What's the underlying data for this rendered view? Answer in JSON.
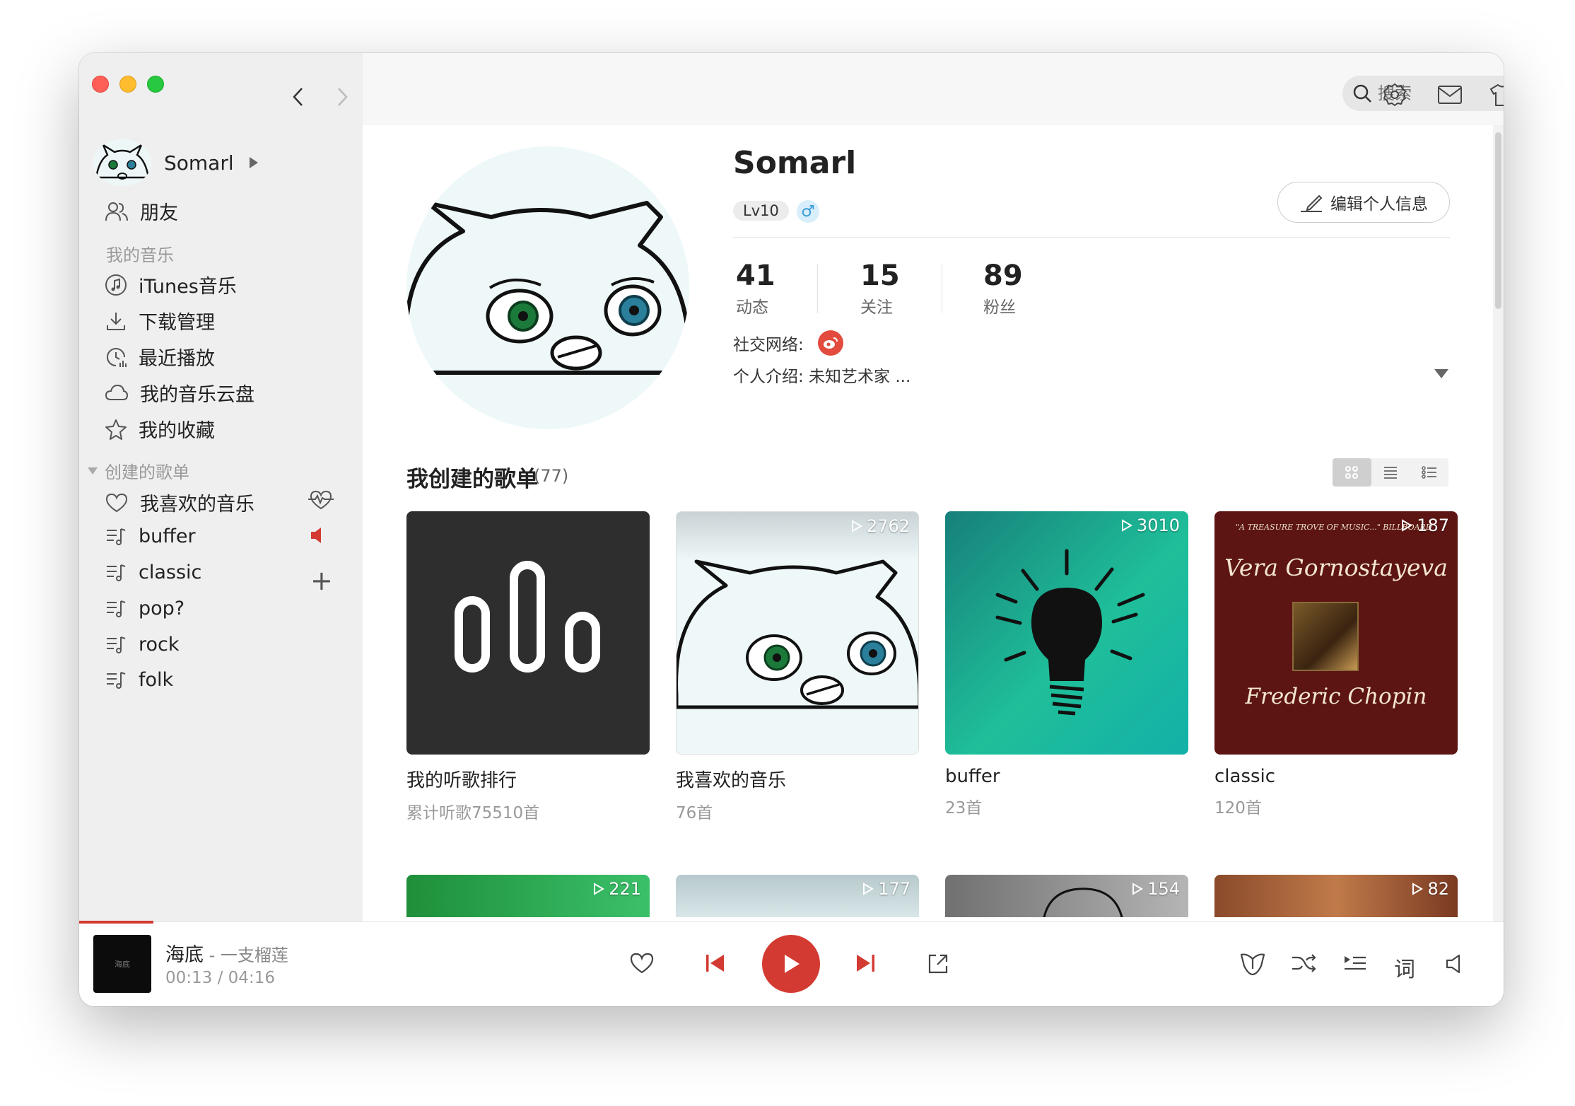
{
  "search": {
    "placeholder": "搜索"
  },
  "user": {
    "name": "Somarl",
    "friends": "朋友"
  },
  "sidebar": {
    "my_music_heading": "我的音乐",
    "items": [
      {
        "label": "iTunes音乐",
        "icon": "music-note-icon"
      },
      {
        "label": "下载管理",
        "icon": "download-icon"
      },
      {
        "label": "最近播放",
        "icon": "clock-icon"
      },
      {
        "label": "我的音乐云盘",
        "icon": "cloud-icon"
      },
      {
        "label": "我的收藏",
        "icon": "star-icon"
      }
    ],
    "created_heading": "创建的歌单",
    "playlists": [
      {
        "label": "我喜欢的音乐",
        "icon": "heart-icon"
      },
      {
        "label": "buffer",
        "icon": "playlist-icon"
      },
      {
        "label": "classic",
        "icon": "playlist-icon"
      },
      {
        "label": "pop?",
        "icon": "playlist-icon"
      },
      {
        "label": "rock",
        "icon": "playlist-icon"
      },
      {
        "label": "folk",
        "icon": "playlist-icon"
      }
    ]
  },
  "profile": {
    "name": "Somarl",
    "level": "Lv10",
    "gender_symbol": "♂",
    "edit_label": "编辑个人信息",
    "stats": [
      {
        "num": "41",
        "label": "动态"
      },
      {
        "num": "15",
        "label": "关注"
      },
      {
        "num": "89",
        "label": "粉丝"
      }
    ],
    "social_label": "社交网络:",
    "intro": "个人介绍: 未知艺术家 ..."
  },
  "playlists_section": {
    "title": "我创建的歌单",
    "count": "(77)",
    "cards": [
      {
        "title": "我的听歌排行",
        "sub": "累计听歌75510首",
        "plays": ""
      },
      {
        "title": "我喜欢的音乐",
        "sub": "76首",
        "plays": "2762"
      },
      {
        "title": "buffer",
        "sub": "23首",
        "plays": "3010"
      },
      {
        "title": "classic",
        "sub": "120首",
        "plays": "187",
        "cover_top": "\"A TREASURE TROVE OF MUSIC...\" BILLBOARD",
        "cover_line1": "Vera Gornostayeva",
        "cover_line2": "Frederic Chopin"
      }
    ],
    "row2_plays": [
      "221",
      "177",
      "154",
      "82"
    ]
  },
  "player": {
    "title": "海底",
    "artist": " - 一支榴莲",
    "current": "00:13",
    "separator": " / ",
    "total": "04:16",
    "cover_text": "海底",
    "progress_fraction": 0.052
  },
  "colors": {
    "accent": "#d33a31",
    "sidebar_bg": "#efefef"
  }
}
